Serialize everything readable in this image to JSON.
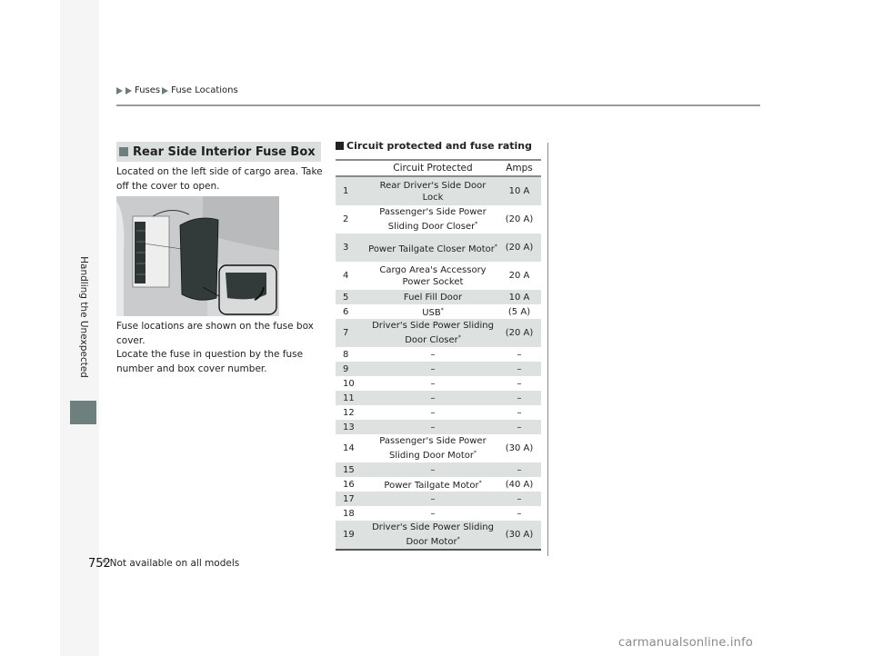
{
  "breadcrumb": {
    "items": [
      "Fuses",
      "Fuse Locations"
    ]
  },
  "sidebar": {
    "section_label": "Handling the Unexpected",
    "tab_color": "#6e807e"
  },
  "section": {
    "heading": "Rear Side Interior Fuse Box",
    "paragraph1": "Located on the left side of cargo area. Take off the cover to open.",
    "paragraph2_line1": "Fuse locations are shown on the fuse box cover.",
    "paragraph2_line2": "Locate the fuse in question by the fuse number and box cover number.",
    "image_alt": "fuse-box-with-cover-removed-illustration"
  },
  "table": {
    "title": "Circuit protected and fuse rating",
    "headers": {
      "number": "",
      "circuit": "Circuit Protected",
      "amps": "Amps"
    },
    "rows": [
      {
        "no": "1",
        "circuit": "Rear Driver's Side Door Lock",
        "starred": false,
        "amps": "10 A"
      },
      {
        "no": "2",
        "circuit": "Passenger's Side Power Sliding Door Closer",
        "starred": true,
        "amps": "(20 A)"
      },
      {
        "no": "3",
        "circuit": "Power Tailgate Closer Motor",
        "starred": true,
        "amps": "(20 A)"
      },
      {
        "no": "4",
        "circuit": "Cargo Area's Accessory Power Socket",
        "starred": false,
        "amps": "20 A"
      },
      {
        "no": "5",
        "circuit": "Fuel Fill Door",
        "starred": false,
        "amps": "10 A"
      },
      {
        "no": "6",
        "circuit": "USB",
        "starred": true,
        "amps": "(5 A)"
      },
      {
        "no": "7",
        "circuit": "Driver's Side Power Sliding Door Closer",
        "starred": true,
        "amps": "(20 A)"
      },
      {
        "no": "8",
        "circuit": "–",
        "starred": false,
        "amps": "–"
      },
      {
        "no": "9",
        "circuit": "–",
        "starred": false,
        "amps": "–"
      },
      {
        "no": "10",
        "circuit": "–",
        "starred": false,
        "amps": "–"
      },
      {
        "no": "11",
        "circuit": "–",
        "starred": false,
        "amps": "–"
      },
      {
        "no": "12",
        "circuit": "–",
        "starred": false,
        "amps": "–"
      },
      {
        "no": "13",
        "circuit": "–",
        "starred": false,
        "amps": "–"
      },
      {
        "no": "14",
        "circuit": "Passenger's Side Power Sliding Door Motor",
        "starred": true,
        "amps": "(30 A)"
      },
      {
        "no": "15",
        "circuit": "–",
        "starred": false,
        "amps": "–"
      },
      {
        "no": "16",
        "circuit": "Power Tailgate Motor",
        "starred": true,
        "amps": "(40 A)"
      },
      {
        "no": "17",
        "circuit": "–",
        "starred": false,
        "amps": "–"
      },
      {
        "no": "18",
        "circuit": "–",
        "starred": false,
        "amps": "–"
      },
      {
        "no": "19",
        "circuit": "Driver's Side Power Sliding Door Motor",
        "starred": true,
        "amps": "(30 A)"
      }
    ],
    "shade_color": "#dde2e1",
    "star_mark": "*"
  },
  "footer": {
    "page_number": "752",
    "note": "* Not available on all models"
  },
  "watermark": "carmanualsonline.info"
}
